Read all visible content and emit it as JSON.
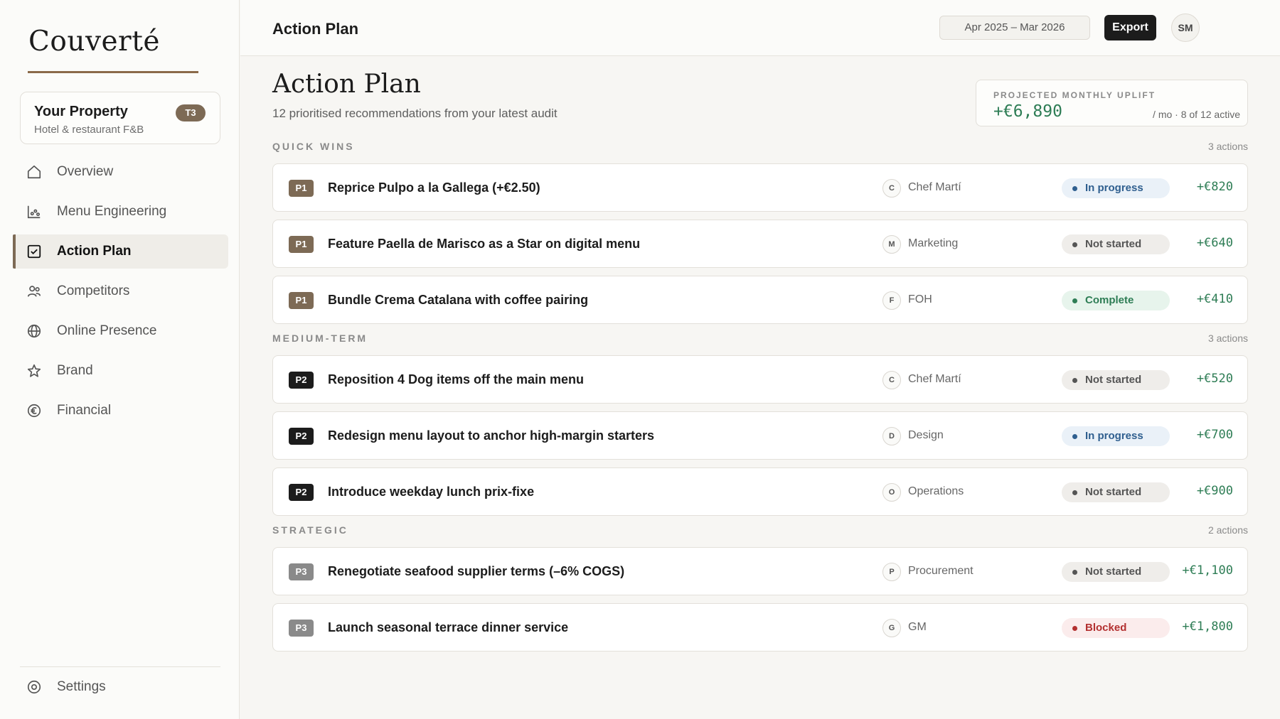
{
  "sidebar": {
    "logo": "Couverté",
    "property": {
      "name": "Your Property",
      "subtitle": "Hotel & restaurant F&B",
      "tier": "T3"
    },
    "items": [
      {
        "label": "Overview",
        "icon": "home-icon"
      },
      {
        "label": "Menu Engineering",
        "icon": "chart-icon"
      },
      {
        "label": "Action Plan",
        "icon": "checkbox-icon",
        "active": true
      },
      {
        "label": "Competitors",
        "icon": "users-icon"
      },
      {
        "label": "Online Presence",
        "icon": "globe-icon"
      },
      {
        "label": "Brand",
        "icon": "star-icon"
      },
      {
        "label": "Financial",
        "icon": "euro-icon"
      }
    ],
    "settings": {
      "label": "Settings",
      "icon": "settings-icon"
    }
  },
  "topbar": {
    "title": "Action Plan",
    "date_range": "Apr 2025 – Mar 2026",
    "export_label": "Export",
    "avatar": "SM"
  },
  "main": {
    "title": "Action Plan",
    "subtitle": "12 prioritised recommendations from your latest audit",
    "uplift": {
      "label": "PROJECTED MONTHLY UPLIFT",
      "value": "+€6,890",
      "meta": "/ mo · 8 of 12 active"
    },
    "sections": [
      {
        "name": "QUICK WINS",
        "count": "3 actions",
        "rows": [
          {
            "priority": "P1",
            "task": "Reprice Pulpo a la Gallega (+€2.50)",
            "owner_initial": "C",
            "owner": "Chef Martí",
            "status": "In progress",
            "amount": "+€820"
          },
          {
            "priority": "P1",
            "task": "Feature Paella de Marisco as a Star on digital menu",
            "owner_initial": "M",
            "owner": "Marketing",
            "status": "Not started",
            "amount": "+€640"
          },
          {
            "priority": "P1",
            "task": "Bundle Crema Catalana with coffee pairing",
            "owner_initial": "F",
            "owner": "FOH",
            "status": "Complete",
            "amount": "+€410"
          }
        ]
      },
      {
        "name": "MEDIUM-TERM",
        "count": "3 actions",
        "rows": [
          {
            "priority": "P2",
            "task": "Reposition 4 Dog items off the main menu",
            "owner_initial": "C",
            "owner": "Chef Martí",
            "status": "Not started",
            "amount": "+€520"
          },
          {
            "priority": "P2",
            "task": "Redesign menu layout to anchor high-margin starters",
            "owner_initial": "D",
            "owner": "Design",
            "status": "In progress",
            "amount": "+€700"
          },
          {
            "priority": "P2",
            "task": "Introduce weekday lunch prix-fixe",
            "owner_initial": "O",
            "owner": "Operations",
            "status": "Not started",
            "amount": "+€900"
          }
        ]
      },
      {
        "name": "STRATEGIC",
        "count": "2 actions",
        "rows": [
          {
            "priority": "P3",
            "task": "Renegotiate seafood supplier terms (–6% COGS)",
            "owner_initial": "P",
            "owner": "Procurement",
            "status": "Not started",
            "amount": "+€1,100"
          },
          {
            "priority": "P3",
            "task": "Launch seasonal terrace dinner service",
            "owner_initial": "G",
            "owner": "GM",
            "status": "Blocked",
            "amount": "+€1,800"
          }
        ]
      }
    ]
  },
  "colors": {
    "accent": "#7d6a55",
    "positive": "#2e7d55",
    "blocked": "#b33030",
    "in_progress": "#2f5f8f"
  }
}
